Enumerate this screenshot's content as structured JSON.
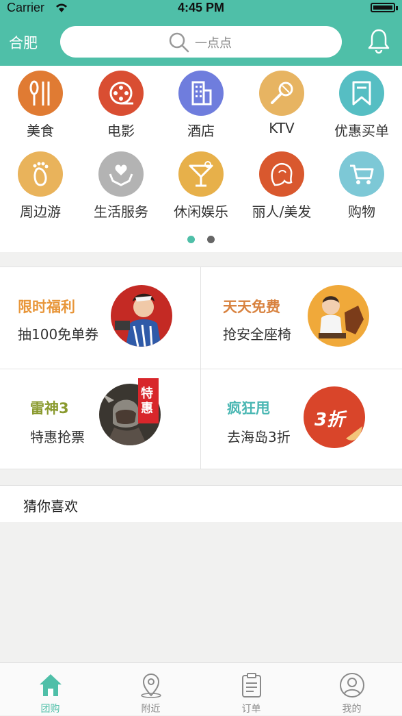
{
  "status_bar": {
    "carrier": "Carrier",
    "time": "4:45 PM"
  },
  "header": {
    "city": "合肥",
    "search_placeholder": "一点点",
    "bell_icon": "bell-icon"
  },
  "categories": [
    {
      "label": "美食",
      "color": "#e07b33",
      "icon": "cutlery-icon"
    },
    {
      "label": "电影",
      "color": "#d94e32",
      "icon": "film-reel-icon"
    },
    {
      "label": "酒店",
      "color": "#6f7ddd",
      "icon": "building-icon"
    },
    {
      "label": "KTV",
      "color": "#e7b462",
      "icon": "microphone-icon"
    },
    {
      "label": "优惠买单",
      "color": "#56bec3",
      "icon": "bookmark-icon"
    },
    {
      "label": "周边游",
      "color": "#e9b35b",
      "icon": "footprint-icon"
    },
    {
      "label": "生活服务",
      "color": "#b3b3b3",
      "icon": "heart-hands-icon"
    },
    {
      "label": "休闲娱乐",
      "color": "#e7b04a",
      "icon": "cocktail-icon"
    },
    {
      "label": "丽人/美发",
      "color": "#d9582e",
      "icon": "woman-hair-icon"
    },
    {
      "label": "购物",
      "color": "#7dc8d6",
      "icon": "cart-icon"
    }
  ],
  "pager": {
    "pages": 2,
    "active": 0,
    "active_color": "#4fbfa8",
    "inactive_color": "#666666"
  },
  "promos": [
    {
      "title": "限时福利",
      "subtitle": "抽100免单券",
      "title_color": "#e8963a"
    },
    {
      "title": "天天免费",
      "subtitle": "抢安全座椅",
      "title_color": "#d8823f"
    },
    {
      "title": "雷神3",
      "subtitle": "特惠抢票",
      "title_color": "#8a9a2f",
      "badge": "特惠"
    },
    {
      "title": "疯狂甩",
      "subtitle": "去海岛3折",
      "title_color": "#4ab7b3",
      "badge": "3折"
    }
  ],
  "guess_section": {
    "title": "猜你喜欢"
  },
  "tabbar": {
    "active_color": "#4fbfa8",
    "inactive_color": "#8a8a8a",
    "tabs": [
      {
        "label": "团购",
        "icon": "home-icon",
        "active": true
      },
      {
        "label": "附近",
        "icon": "location-pin-icon",
        "active": false
      },
      {
        "label": "订单",
        "icon": "clipboard-icon",
        "active": false
      },
      {
        "label": "我的",
        "icon": "user-icon",
        "active": false
      }
    ]
  }
}
